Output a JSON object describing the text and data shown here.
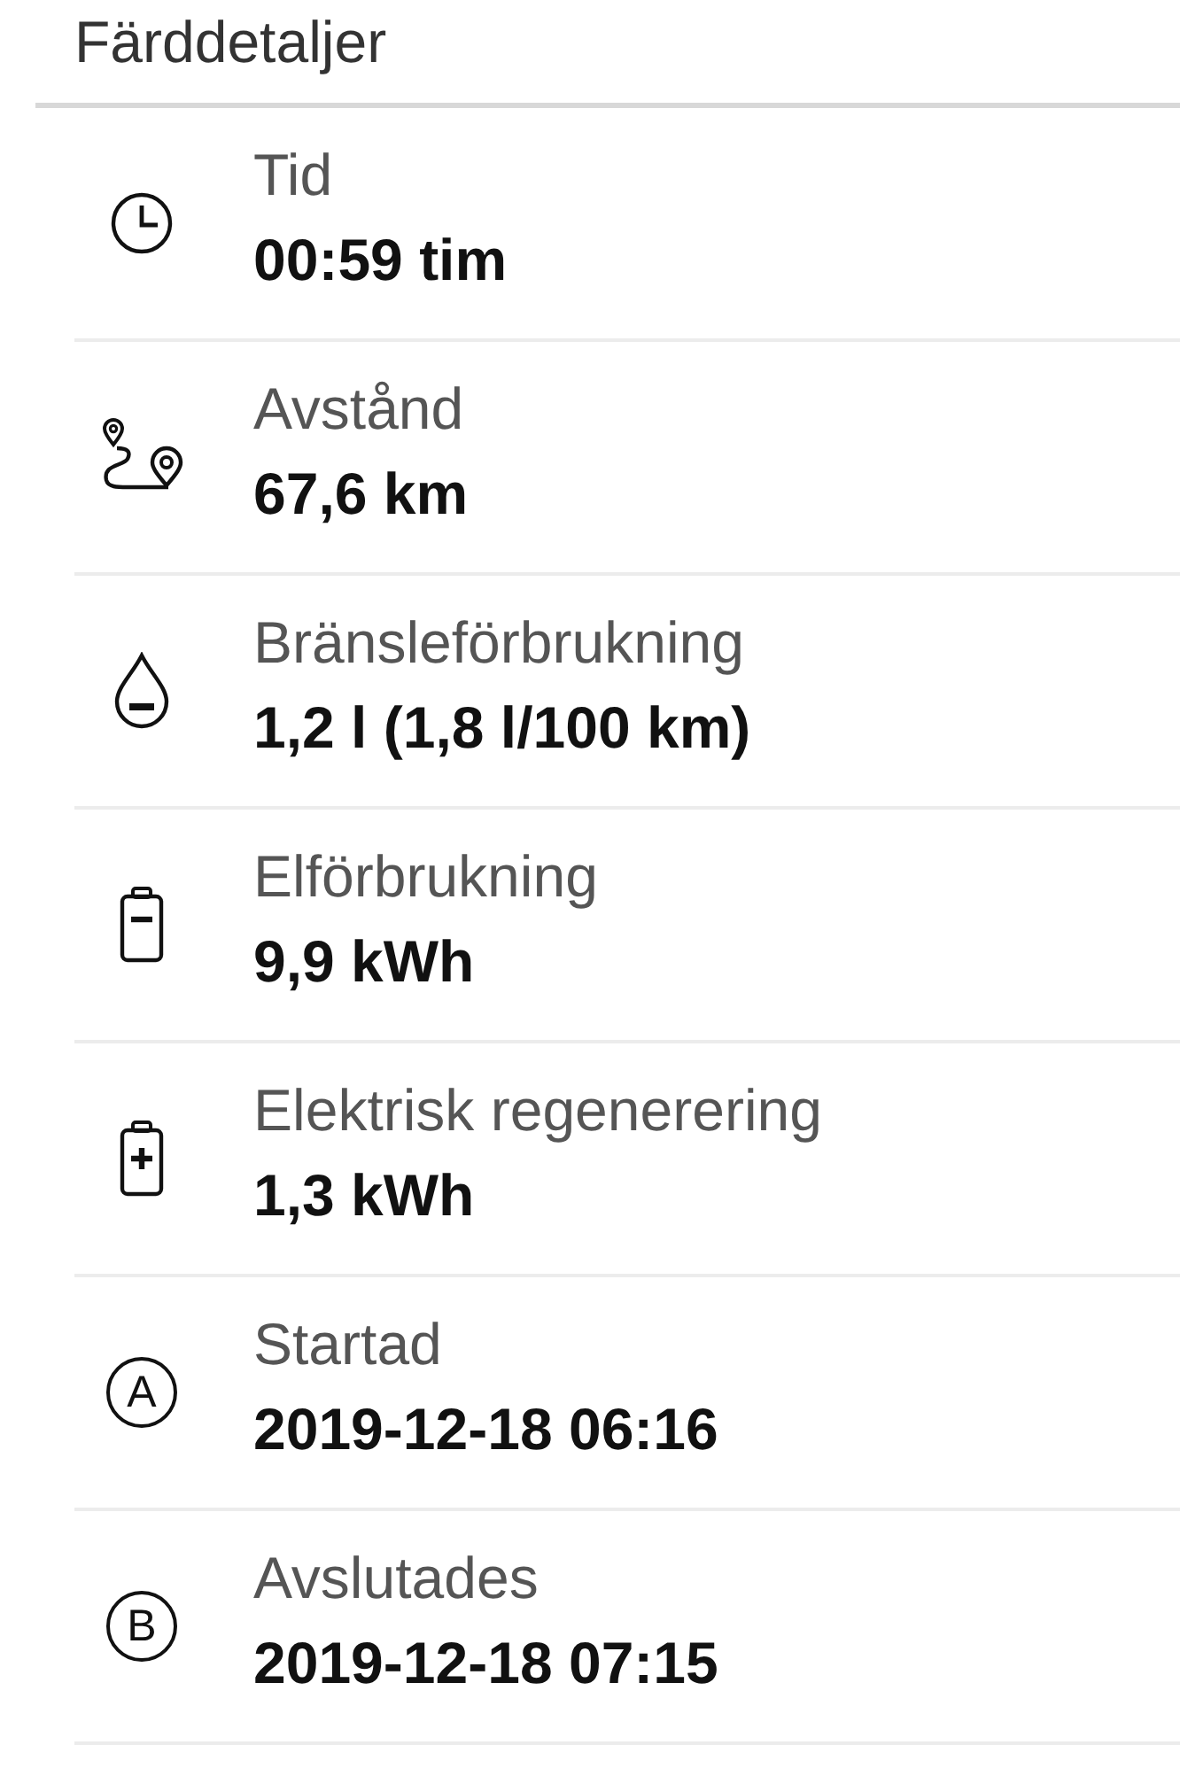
{
  "title": "Färddetaljer",
  "rows": [
    {
      "kind": "clock",
      "label": "Tid",
      "value": "00:59 tim"
    },
    {
      "kind": "route",
      "label": "Avstånd",
      "value": "67,6 km"
    },
    {
      "kind": "drop",
      "label": "Bränsleförbrukning",
      "value": "1,2 l (1,8 l/100 km)"
    },
    {
      "kind": "battery-minus",
      "label": "Elförbrukning",
      "value": "9,9 kWh"
    },
    {
      "kind": "battery-plus",
      "label": "Elektrisk regenerering",
      "value": "1,3 kWh"
    },
    {
      "kind": "letter",
      "letter": "A",
      "label": "Startad",
      "value": "2019-12-18 06:16"
    },
    {
      "kind": "letter",
      "letter": "B",
      "label": "Avslutades",
      "value": "2019-12-18 07:15"
    }
  ]
}
